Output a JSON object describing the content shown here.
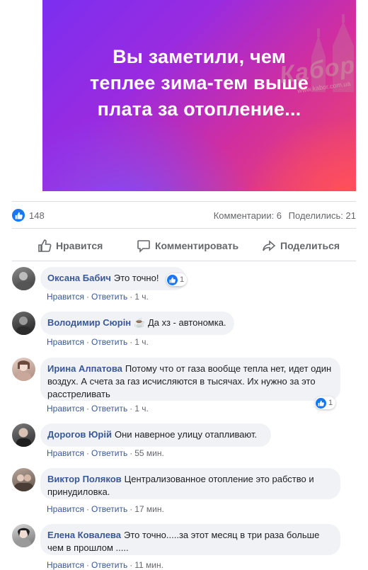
{
  "post": {
    "caption": "Вы заметили, чем\nтеплее зима-тем выше\nплата за отопление...",
    "watermark": "Кабор",
    "watermark_site": "www.kabor.com.ua"
  },
  "stats": {
    "likes": "148",
    "comments": "Комментарии: 6",
    "shares": "Поделились: 21"
  },
  "actions": {
    "like": "Нравится",
    "comment": "Комментировать",
    "share": "Поделиться"
  },
  "meta_labels": {
    "like": "Нравится",
    "reply": "Ответить",
    "dot": "·"
  },
  "comments": [
    {
      "author": "Оксана Бабич",
      "text": "Это точно!",
      "time": "1 ч.",
      "reactions": "1"
    },
    {
      "author": "Володимир Сюрін",
      "emoji": "☕",
      "text": "Да хз - автономка.",
      "time": "1 ч."
    },
    {
      "author": "Ирина Алпатова",
      "text": "Потому что от газа вообще тепла нет, идет один воздух. А счета за газ исчисляются в тысячах. Их нужно за это расстреливать",
      "time": "1 ч.",
      "reactions": "1"
    },
    {
      "author": "Дорогов Юрій",
      "text": "Они наверное улицу отапливают.",
      "time": "55 мин."
    },
    {
      "author": "Виктор Поляков",
      "text": "Централизованное отопление это рабство и принудиловка.",
      "time": "17 мин."
    },
    {
      "author": "Елена Ковалева",
      "text": "Это точно.....за этот месяц в три раза больше чем в прошлом .....",
      "time": "11 мин."
    }
  ],
  "colors": {
    "accent": "#1877f2",
    "link": "#385898",
    "bubble": "#f0f2f5",
    "muted": "#65676b"
  }
}
